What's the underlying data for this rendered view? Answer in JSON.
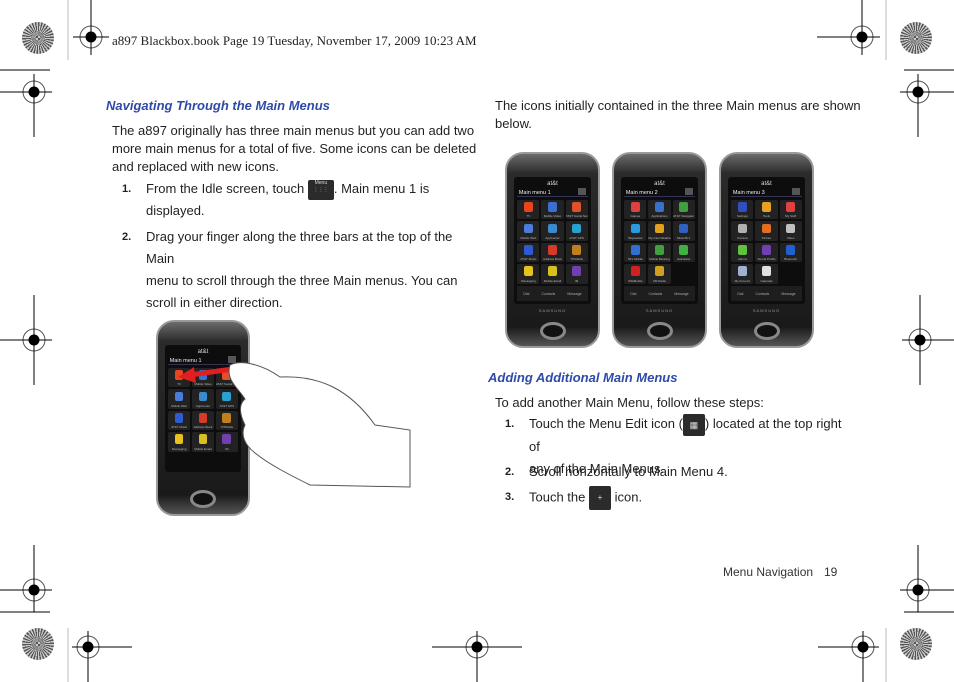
{
  "header": {
    "text": "a897 Blackbox.book  Page 19  Tuesday, November 17, 2009  10:23 AM"
  },
  "left": {
    "heading": "Navigating Through the Main Menus",
    "intro": [
      "The a897 originally has three main menus but you can add two",
      "more main menus for a total of five. Some icons can be deleted",
      "and replaced with new icons."
    ],
    "steps": [
      {
        "num": "1.",
        "before": "From the Idle screen, touch ",
        "icon": "menu-icon",
        "icon_label": "Menu",
        "after": ". Main menu 1 is",
        "line2": "displayed."
      },
      {
        "num": "2.",
        "lines": [
          "Drag your finger along the three bars at the top of the Main",
          "menu to scroll through the three Main menus. You can",
          "scroll in either direction."
        ]
      }
    ],
    "phone": {
      "carrier": "at&t",
      "title": "Main menu 1"
    }
  },
  "right": {
    "intro": [
      "The icons initially contained in the three Main menus are shown",
      "below."
    ],
    "phones": [
      {
        "carrier": "at&t",
        "title": "Main menu 1",
        "icons": [
          {
            "label": "TV",
            "color": "#e8451e"
          },
          {
            "label": "Mobile Video",
            "color": "#3b6fd0"
          },
          {
            "label": "AT&T Social Net",
            "color": "#e0502a"
          },
          {
            "label": "Mobile Web",
            "color": "#4a7cd8"
          },
          {
            "label": "AppCenter",
            "color": "#3a8ad0"
          },
          {
            "label": "AT&T GPS",
            "color": "#2aa0d0"
          },
          {
            "label": "AT&T Music",
            "color": "#2f5bd0"
          },
          {
            "label": "Address Book",
            "color": "#d83a2a"
          },
          {
            "label": "YPMobile",
            "color": "#c08020"
          },
          {
            "label": "Messaging",
            "color": "#e8c020"
          },
          {
            "label": "Mobile Email",
            "color": "#d8c020"
          },
          {
            "label": "IM",
            "color": "#7040b0"
          }
        ]
      },
      {
        "carrier": "at&t",
        "title": "Main menu 2",
        "icons": [
          {
            "label": "Games",
            "color": "#e04040"
          },
          {
            "label": "Applications",
            "color": "#3a70c8"
          },
          {
            "label": "AT&T Navigator",
            "color": "#40a040"
          },
          {
            "label": "Bejeweled",
            "color": "#2a9ae0"
          },
          {
            "label": "My-Cast Weather",
            "color": "#e0a020"
          },
          {
            "label": "MusicID 2",
            "color": "#3060c0"
          },
          {
            "label": "NFL Mobile",
            "color": "#3070d0"
          },
          {
            "label": "Mobile Banking",
            "color": "#40a040"
          },
          {
            "label": "Calculator",
            "color": "#40b040"
          },
          {
            "label": "WikiMobile",
            "color": "#d02020"
          },
          {
            "label": "XM Radio",
            "color": "#d0a020"
          },
          {
            "label": "",
            "color": ""
          }
        ]
      },
      {
        "carrier": "at&t",
        "title": "Main menu 3",
        "icons": [
          {
            "label": "Settings",
            "color": "#3050c0"
          },
          {
            "label": "Tools",
            "color": "#e8a020"
          },
          {
            "label": "My Stuff",
            "color": "#e04040"
          },
          {
            "label": "Camera",
            "color": "#b0b0b0"
          },
          {
            "label": "Picture",
            "color": "#e07020"
          },
          {
            "label": "Video",
            "color": "#c0c0c0"
          },
          {
            "label": "Alarms",
            "color": "#60c040"
          },
          {
            "label": "Sound Profile",
            "color": "#7040b0"
          },
          {
            "label": "Bluetooth",
            "color": "#2060d0"
          },
          {
            "label": "My Account",
            "color": "#a0b0d0"
          },
          {
            "label": "Calendar",
            "color": "#e0e0e0"
          },
          {
            "label": "",
            "color": ""
          }
        ]
      }
    ],
    "dock": [
      "Dial",
      "Contacts",
      "Message"
    ],
    "brand": "SAMSUNG",
    "heading": "Adding Additional Main Menus",
    "intro2": "To add another Main Menu, follow these steps:",
    "steps": [
      {
        "num": "1.",
        "before": "Touch the Menu Edit icon (",
        "icon": "menu-edit-icon",
        "after": ") located at the top right of",
        "line2": "any of the Main Menus."
      },
      {
        "num": "2.",
        "text": "Scroll horizontally to Main Menu 4."
      },
      {
        "num": "3.",
        "before": "Touch the ",
        "icon": "plus-icon",
        "icon_label": "+",
        "after": " icon."
      }
    ]
  },
  "footer": {
    "section": "Menu Navigation",
    "page": "19"
  }
}
